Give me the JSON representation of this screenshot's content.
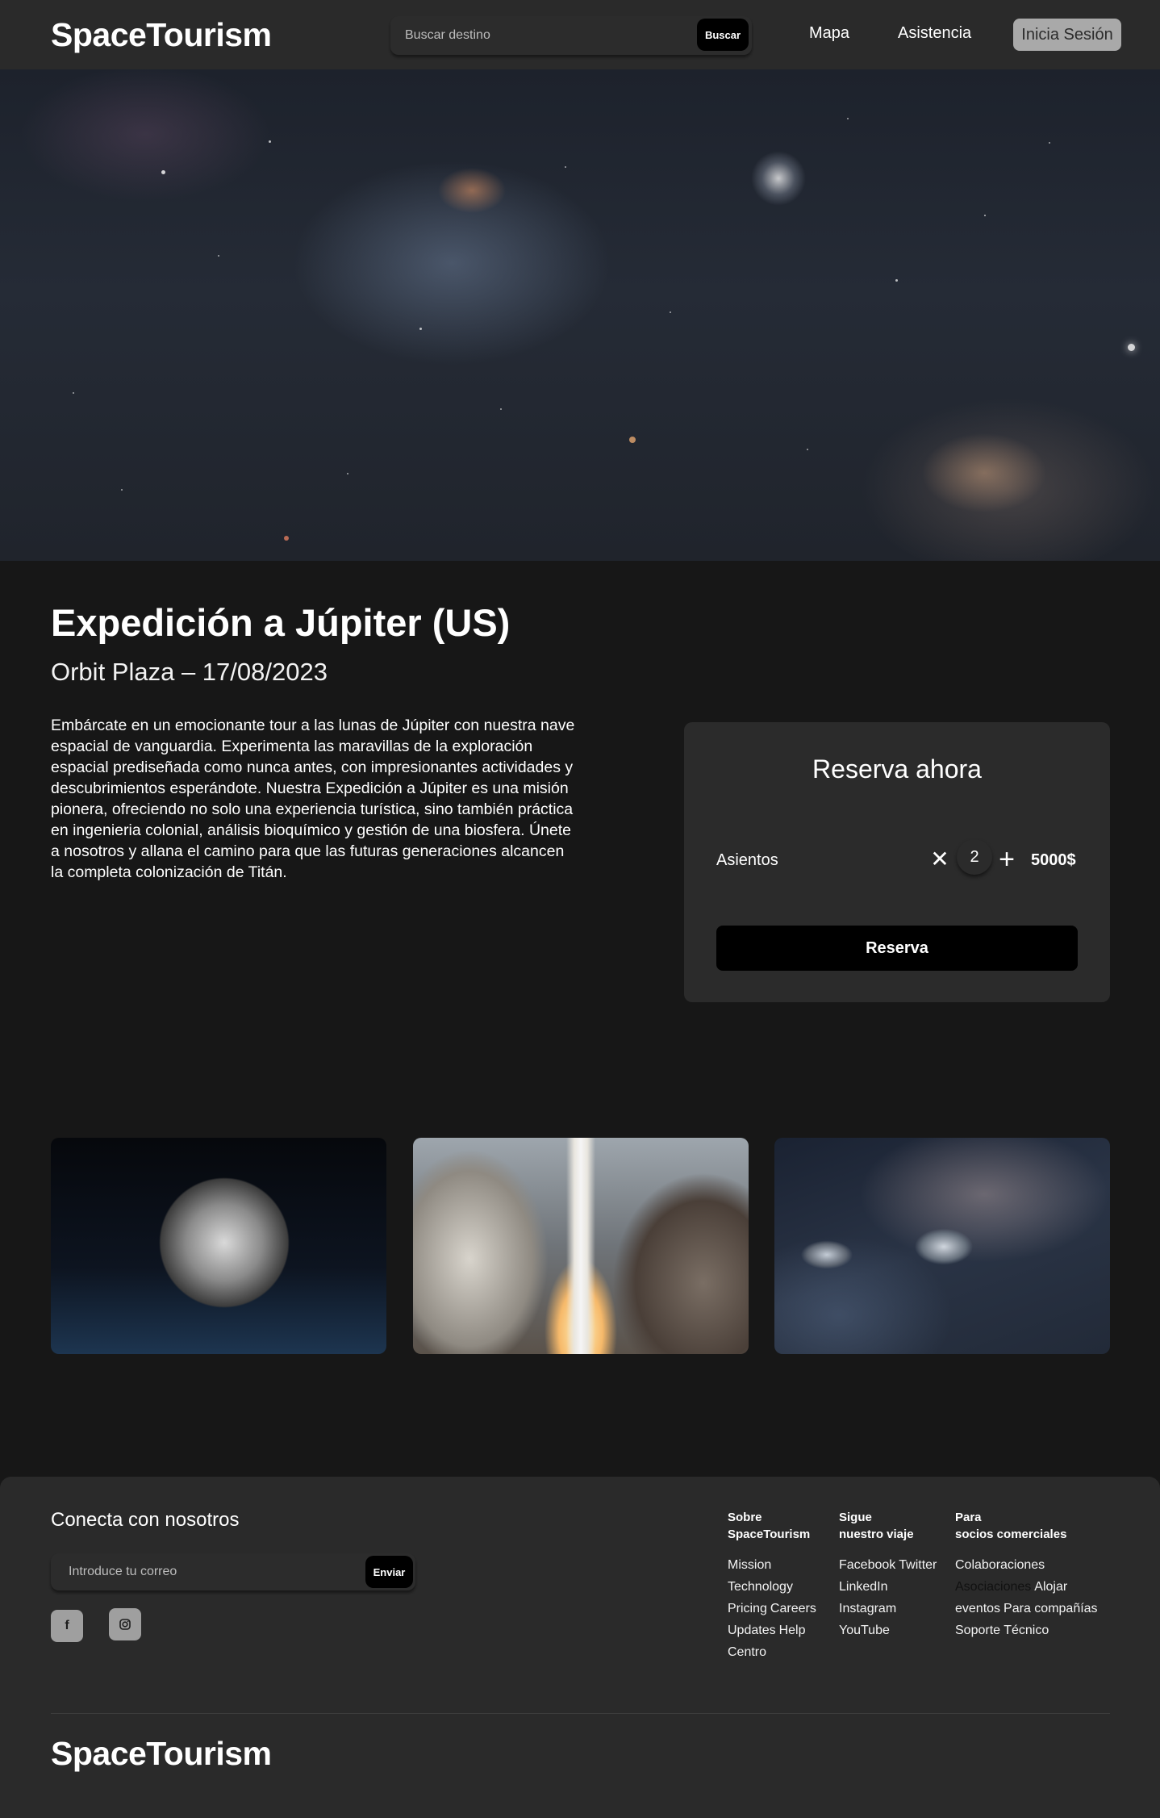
{
  "header": {
    "logo": "SpaceTourism",
    "search": {
      "placeholder": "Buscar destino",
      "button": "Buscar"
    },
    "nav": [
      "Mapa",
      "Asistencia"
    ],
    "login": "Inicia Sesión"
  },
  "trip": {
    "title": "Expedición a Júpiter (US)",
    "subtitle": "Orbit Plaza – 17/08/2023",
    "description": "Embárcate en un emocionante tour a las lunas de Júpiter con nuestra nave espacial de vanguardia. Experimenta las maravillas de la exploración espacial prediseñada como nunca antes, con impresionantes actividades y descubrimientos esperándote. Nuestra Expedición a Júpiter es una misión pionera, ofreciendo no solo una experiencia turística, sino también práctica en ingenieria colonial, análisis bioquímico y gestión de una biosfera. Únete a nosotros y allana el camino para que las futuras generaciones alcancen la completa colonización de Titán."
  },
  "booking": {
    "title": "Reserva ahora",
    "seats_label": "Asientos",
    "remove_symbol": "✕",
    "seats": "2",
    "add_symbol": "+",
    "price": "5000$",
    "button": "Reserva"
  },
  "footer": {
    "connect_title": "Conecta con nosotros",
    "email": {
      "placeholder": "Introduce tu correo",
      "button": "Enviar"
    },
    "social_icons": [
      "facebook-icon",
      "instagram-icon"
    ],
    "columns": [
      {
        "title": "Sobre\nSpaceTourism",
        "links": [
          "Mission",
          "Technology",
          "Pricing",
          "Careers",
          "Updates",
          "Help",
          "Centro"
        ]
      },
      {
        "title": "Sigue\nnuestro viaje",
        "links": [
          "Facebook",
          "Twitter",
          "LinkedIn",
          "Instagram",
          "YouTube"
        ]
      },
      {
        "title": "Para\nsocios comerciales",
        "links": [
          "Colaboraciones",
          "Asociaciones",
          "Alojar",
          "eventos",
          "Para compañías",
          "Soporte Técnico"
        ]
      }
    ],
    "logo": "SpaceTourism"
  },
  "colors": {
    "background": "#171717",
    "header": "#2a2a2a",
    "card": "#2b2b2b",
    "button": "#000000",
    "login_button": "#a9a9a9"
  }
}
